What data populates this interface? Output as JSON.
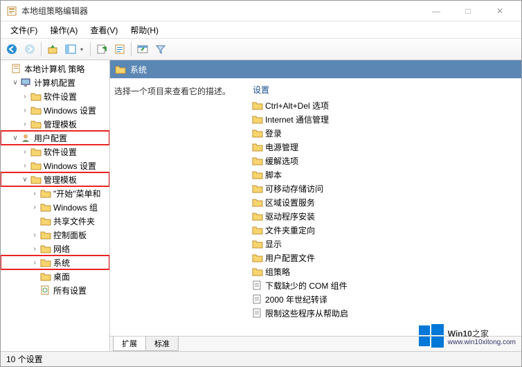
{
  "window": {
    "title": "本地组策略编辑器",
    "min": "—",
    "max": "□",
    "close": "✕"
  },
  "menubar": [
    "文件(F)",
    "操作(A)",
    "查看(V)",
    "帮助(H)"
  ],
  "tree": {
    "root": "本地计算机 策略",
    "computerConfig": "计算机配置",
    "cc_children": [
      "软件设置",
      "Windows 设置",
      "管理模板"
    ],
    "userConfig": "用户配置",
    "uc_children": [
      "软件设置",
      "Windows 设置"
    ],
    "adminTemplates": "管理模板",
    "at_children": [
      "\"开始\"菜单和",
      "Windows 组",
      "共享文件夹",
      "控制面板",
      "网络"
    ],
    "system": "系统",
    "at_after": [
      "桌面",
      "所有设置"
    ]
  },
  "content": {
    "headerTitle": "系统",
    "description": "选择一个项目来查看它的描述。",
    "settingsHeader": "设置",
    "folders": [
      "Ctrl+Alt+Del 选项",
      "Internet 通信管理",
      "登录",
      "电源管理",
      "缓解选项",
      "脚本",
      "可移动存储访问",
      "区域设置服务",
      "驱动程序安装",
      "文件夹重定向",
      "显示",
      "用户配置文件",
      "组策略"
    ],
    "files": [
      "下载缺少的 COM 组件",
      "2000 年世纪转译",
      "限制这些程序从帮助启"
    ]
  },
  "tabs": {
    "extended": "扩展",
    "standard": "标准"
  },
  "statusbar": "10 个设置",
  "watermark": {
    "brand": "Win10",
    "suffix": "之家",
    "url": "www.win10xitong.com"
  }
}
